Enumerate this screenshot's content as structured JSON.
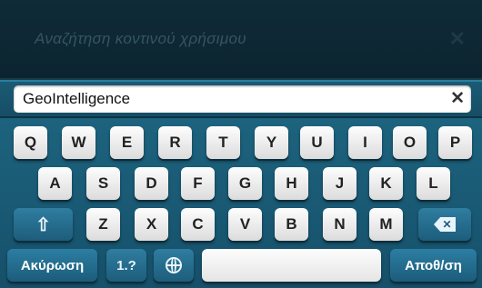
{
  "search": {
    "background_placeholder": "Αναζήτηση κοντινού χρήσιμου",
    "value": "GeoIntelligence"
  },
  "keyboard": {
    "row1": [
      "Q",
      "W",
      "E",
      "R",
      "T",
      "Y",
      "U",
      "I",
      "O",
      "P"
    ],
    "row2": [
      "A",
      "S",
      "D",
      "F",
      "G",
      "H",
      "J",
      "K",
      "L"
    ],
    "row3": [
      "Z",
      "X",
      "C",
      "V",
      "B",
      "N",
      "M"
    ],
    "cancel_label": "Ακύρωση",
    "numbers_label": "1.?",
    "save_label": "Αποθ/ση"
  },
  "icons": {
    "clear": "close-icon",
    "shift": "shift-icon",
    "backspace": "backspace-icon",
    "globe": "globe-icon"
  },
  "colors": {
    "keyboard_bg": "#1d637e",
    "action_key": "#2c7ea3",
    "key_face": "#fdfdfd"
  }
}
